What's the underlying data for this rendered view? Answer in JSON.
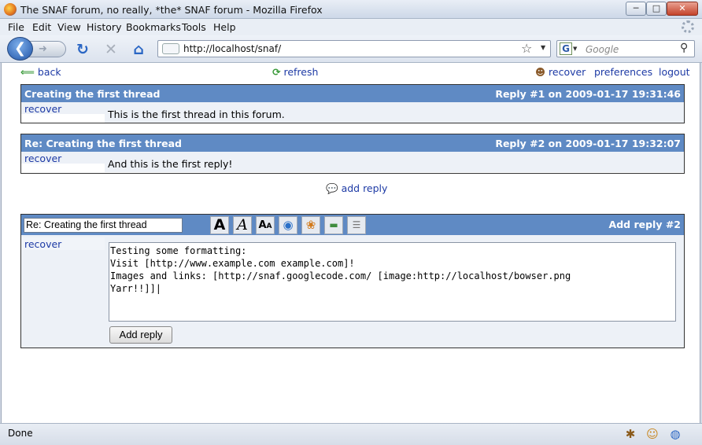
{
  "window": {
    "title": "The SNAF forum, no really, *the* SNAF forum - Mozilla Firefox",
    "min": "─",
    "max": "□",
    "close": "✕"
  },
  "menu": [
    "File",
    "Edit",
    "View",
    "History",
    "Bookmarks",
    "Tools",
    "Help"
  ],
  "nav": {
    "url": "http://localhost/snaf/",
    "search_placeholder": "Google"
  },
  "toplinks": {
    "back": "back",
    "refresh": "refresh",
    "recover": "recover",
    "preferences": "preferences",
    "logout": "logout"
  },
  "posts": [
    {
      "title": "Creating the first thread",
      "meta": "Reply #1 on 2009-01-17 19:31:46",
      "side": "recover",
      "body": "This is the first thread in this forum."
    },
    {
      "title": "Re: Creating the first thread",
      "meta": "Reply #2 on 2009-01-17 19:32:07",
      "side": "recover",
      "body": "And this is the first reply!"
    }
  ],
  "add_reply_link": "add reply",
  "editor": {
    "subject": "Re: Creating the first thread",
    "header_right": "Add reply #2",
    "side": "recover",
    "text": "Testing some formatting:\nVisit [http://www.example.com example.com]!\nImages and links: [http://snaf.googlecode.com/ [image:http://localhost/bowser.png\nYarr!!]]|",
    "submit": "Add reply"
  },
  "status": {
    "text": "Done"
  },
  "colors": {
    "header": "#5f8ac4",
    "link": "#1d3aa5",
    "row_bg": "#edf1f7"
  }
}
